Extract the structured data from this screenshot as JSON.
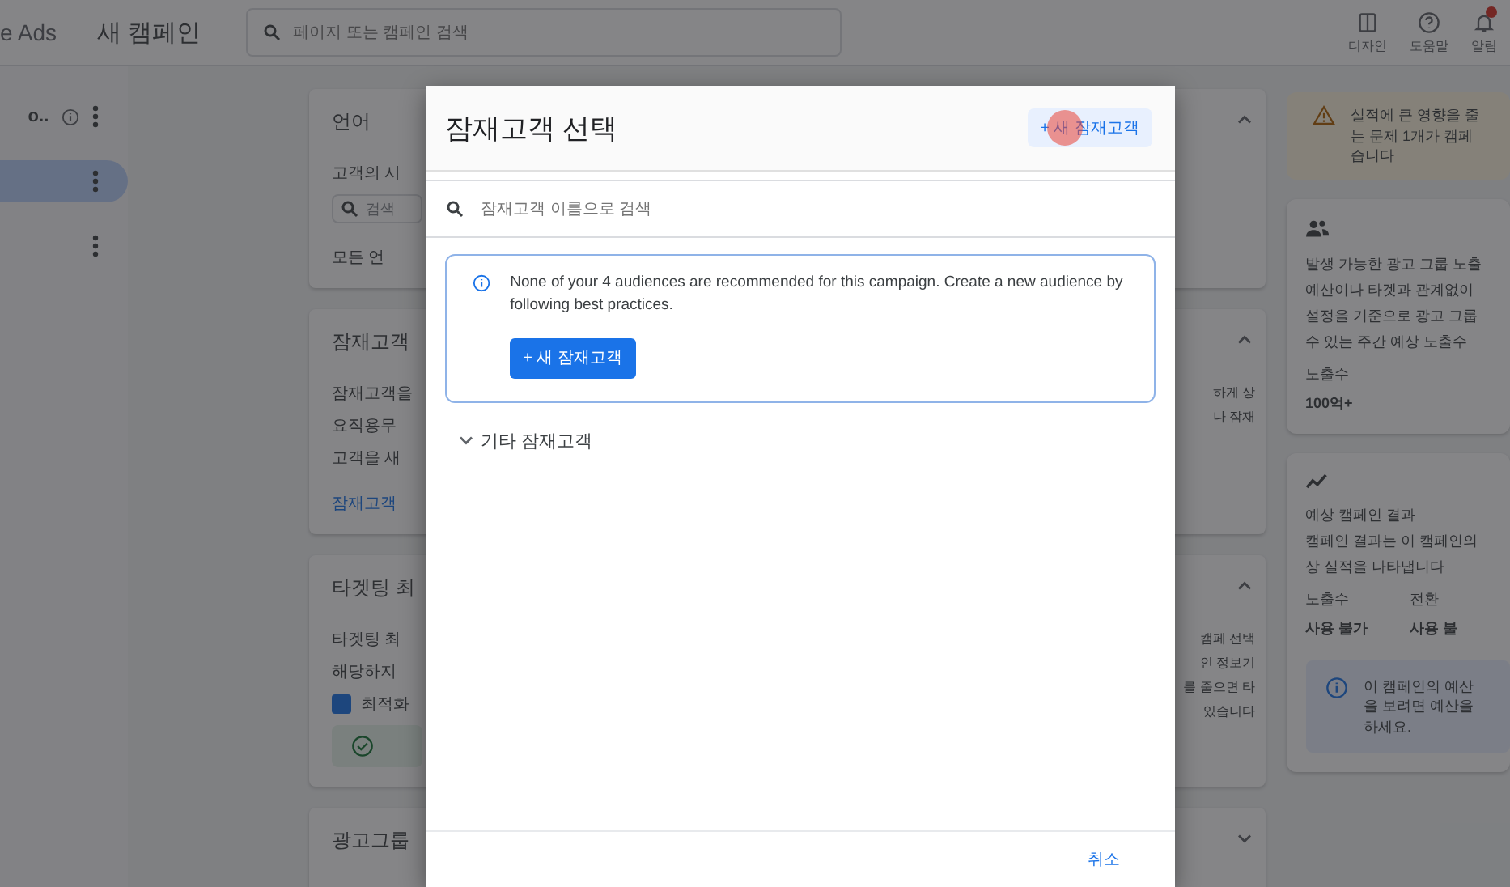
{
  "topbar": {
    "product": "e Ads",
    "title": "새 캠페인",
    "search": {
      "placeholder": "페이지 또는 캠페인 검색"
    },
    "actions": [
      {
        "kind": "appearance",
        "label": "디자인",
        "badge": false
      },
      {
        "kind": "help",
        "label": "도움말",
        "badge": false
      },
      {
        "kind": "notifications",
        "label": "알림",
        "badge": true
      }
    ]
  },
  "sidebar": {
    "items": [
      {
        "label": "o..",
        "selected": false,
        "info": true
      },
      {
        "selected": true
      },
      {
        "selected": false
      }
    ]
  },
  "sections": [
    {
      "title": "언어",
      "expanded": true,
      "lines": [
        "고객의 시"
      ],
      "field_placeholder": "검색",
      "note": "모든 언"
    },
    {
      "title": "잠재고객",
      "expanded": true,
      "lines": [
        "잠재고객을",
        "요직용무",
        "고객을 새"
      ],
      "link": "잠재고객",
      "side_lines": [
        "하게 상",
        "나 잠재"
      ]
    },
    {
      "title": "타겟팅 최",
      "expanded": true,
      "lines": [
        "타겟팅 최",
        "해당하지"
      ],
      "checkbox": {
        "label": "최적화",
        "checked": true
      },
      "status": true,
      "side_lines": [
        "캠페 선택",
        "인 정보기",
        "를 줄으면 타",
        "있습니다"
      ]
    },
    {
      "title": "광고그룹",
      "expanded": false
    }
  ],
  "right_panel": {
    "notice": {
      "lines": [
        "실적에 큰 영향을 줄",
        "는 문제 1개가 캠페",
        "습니다"
      ]
    },
    "cards": [
      {
        "kind": "reach",
        "lines": [
          "발생 가능한 광고 그룹 노출",
          "예산이나 타겟과 관계없이",
          "설정을 기준으로 광고 그룹",
          "수 있는 주간 예상 노출수"
        ],
        "metrics": [
          {
            "label": "노출수",
            "value": "100억+"
          }
        ]
      },
      {
        "kind": "results",
        "lines": [
          "예상 캠페인 결과",
          "캠페인 결과는 이 캠페인의",
          "상 실적을 나타냅니다"
        ],
        "metrics": [
          {
            "label": "노출수",
            "value": "사용 불가"
          },
          {
            "label": "전환",
            "value": "사용 불"
          }
        ],
        "info": [
          "이 캠페인의 예산",
          "을 보려면 예산을",
          "하세요."
        ]
      }
    ]
  },
  "dialog": {
    "title": "잠재고객 선택",
    "header_button": "+ 새 잠재고객",
    "search": {
      "placeholder": "잠재고객 이름으로 검색"
    },
    "notice": {
      "text": "None of your 4 audiences are recommended for this campaign. Create a new audience by following best practices.",
      "button": "+ 새 잠재고객"
    },
    "group": {
      "label": "기타 잠재고객",
      "expanded": false
    },
    "cancel": "취소"
  }
}
